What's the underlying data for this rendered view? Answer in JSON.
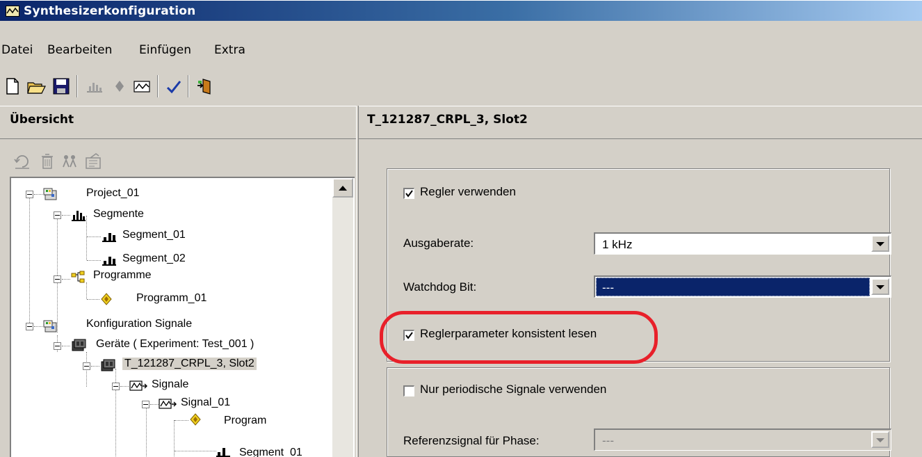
{
  "window": {
    "title": "Synthesizerkonfiguration"
  },
  "menu": [
    {
      "label": "Datei"
    },
    {
      "label": "Bearbeiten"
    },
    {
      "label": "Einfügen"
    },
    {
      "label": "Extra"
    }
  ],
  "toolbar": {
    "icons": [
      "new-file-icon",
      "open-folder-icon",
      "save-icon",
      "segment-chart-icon",
      "program-diamond-icon",
      "signal-wave-icon",
      "check-icon",
      "exit-door-icon"
    ]
  },
  "left_panel": {
    "header": "Übersicht",
    "small_toolbar_icons": [
      "undo-icon",
      "delete-icon",
      "group-icon",
      "properties-icon"
    ]
  },
  "tree": [
    {
      "label": "Project_01",
      "icon": "project-icon"
    },
    {
      "label": "Segmente",
      "icon": "segment-folder-icon"
    },
    {
      "label": "Segment_01",
      "icon": "segment-icon"
    },
    {
      "label": "Segment_02",
      "icon": "segment-icon"
    },
    {
      "label": "Programme",
      "icon": "programme-folder-icon"
    },
    {
      "label": "Programm_01",
      "icon": "program-icon"
    },
    {
      "label": "Konfiguration Signale",
      "icon": "project-icon"
    },
    {
      "label": "Geräte ( Experiment: Test_001 )",
      "icon": "device-icon"
    },
    {
      "label": "T_121287_CRPL_3, Slot2",
      "icon": "device-icon",
      "selected": true
    },
    {
      "label": "Signale",
      "icon": "signal-folder-icon"
    },
    {
      "label": "Signal_01",
      "icon": "signal-icon"
    },
    {
      "label": "Program",
      "icon": "program-icon"
    },
    {
      "label": "Segment_01",
      "icon": "segment-icon"
    }
  ],
  "right_panel": {
    "header": "T_121287_CRPL_3, Slot2",
    "regler_verwenden": {
      "label": "Regler verwenden",
      "checked": true
    },
    "ausgaberate": {
      "label": "Ausgaberate:",
      "value": "1 kHz"
    },
    "watchdog": {
      "label": "Watchdog Bit:",
      "value": "---"
    },
    "reglerparameter": {
      "label": "Reglerparameter konsistent lesen",
      "checked": true
    },
    "nur_periodische": {
      "label": "Nur periodische Signale verwenden",
      "checked": false
    },
    "referenzsignal": {
      "label": "Referenzsignal für Phase:",
      "value": "---"
    }
  },
  "colors": {
    "title_bar_start": "#0a246a",
    "title_bar_end": "#a6caf0",
    "face": "#d4d0c8",
    "highlight_ring": "#e8202a",
    "selection": "#0a246a"
  }
}
